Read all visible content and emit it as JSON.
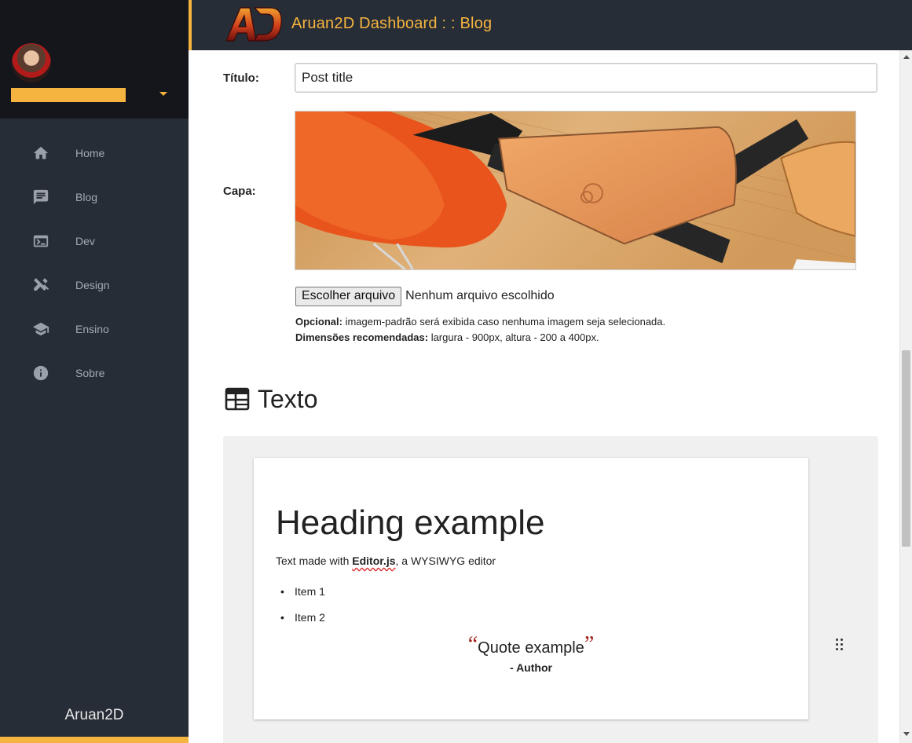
{
  "header": {
    "title": "Aruan2D Dashboard : : Blog",
    "logo_text": "AD"
  },
  "sidebar": {
    "items": [
      {
        "label": "Home",
        "icon": "home-icon"
      },
      {
        "label": "Blog",
        "icon": "chat-icon"
      },
      {
        "label": "Dev",
        "icon": "terminal-icon"
      },
      {
        "label": "Design",
        "icon": "design-tools-icon"
      },
      {
        "label": "Ensino",
        "icon": "school-icon"
      },
      {
        "label": "Sobre",
        "icon": "info-icon"
      }
    ],
    "footer": "Aruan2D"
  },
  "form": {
    "title_label": "Título:",
    "title_value": "Post title",
    "cover_label": "Capa:",
    "file_button": "Escolher arquivo",
    "file_status": "Nenhum arquivo escolhido",
    "hint1_bold": "Opcional:",
    "hint1_text": " imagem-padrão será exibida caso nenhuma imagem seja selecionada.",
    "hint2_bold": "Dimensões recomendadas:",
    "hint2_text": " largura - 900px, altura - 200 a 400px."
  },
  "section": {
    "title": "Texto",
    "icon": "web-layout-icon"
  },
  "editor": {
    "heading": "Heading example",
    "paragraph_before": "Text made with ",
    "paragraph_bold": "Editor.js",
    "paragraph_after": ", a WYSIWYG editor",
    "list": [
      "Item 1",
      "Item 2"
    ],
    "quote_open": "“",
    "quote": "Quote example",
    "quote_close": "”",
    "author": "- Author"
  },
  "colors": {
    "accent": "#f5b43f",
    "sidebar": "#272d37",
    "sidebar_top": "#14161b",
    "quote_mark": "#a3201c"
  }
}
